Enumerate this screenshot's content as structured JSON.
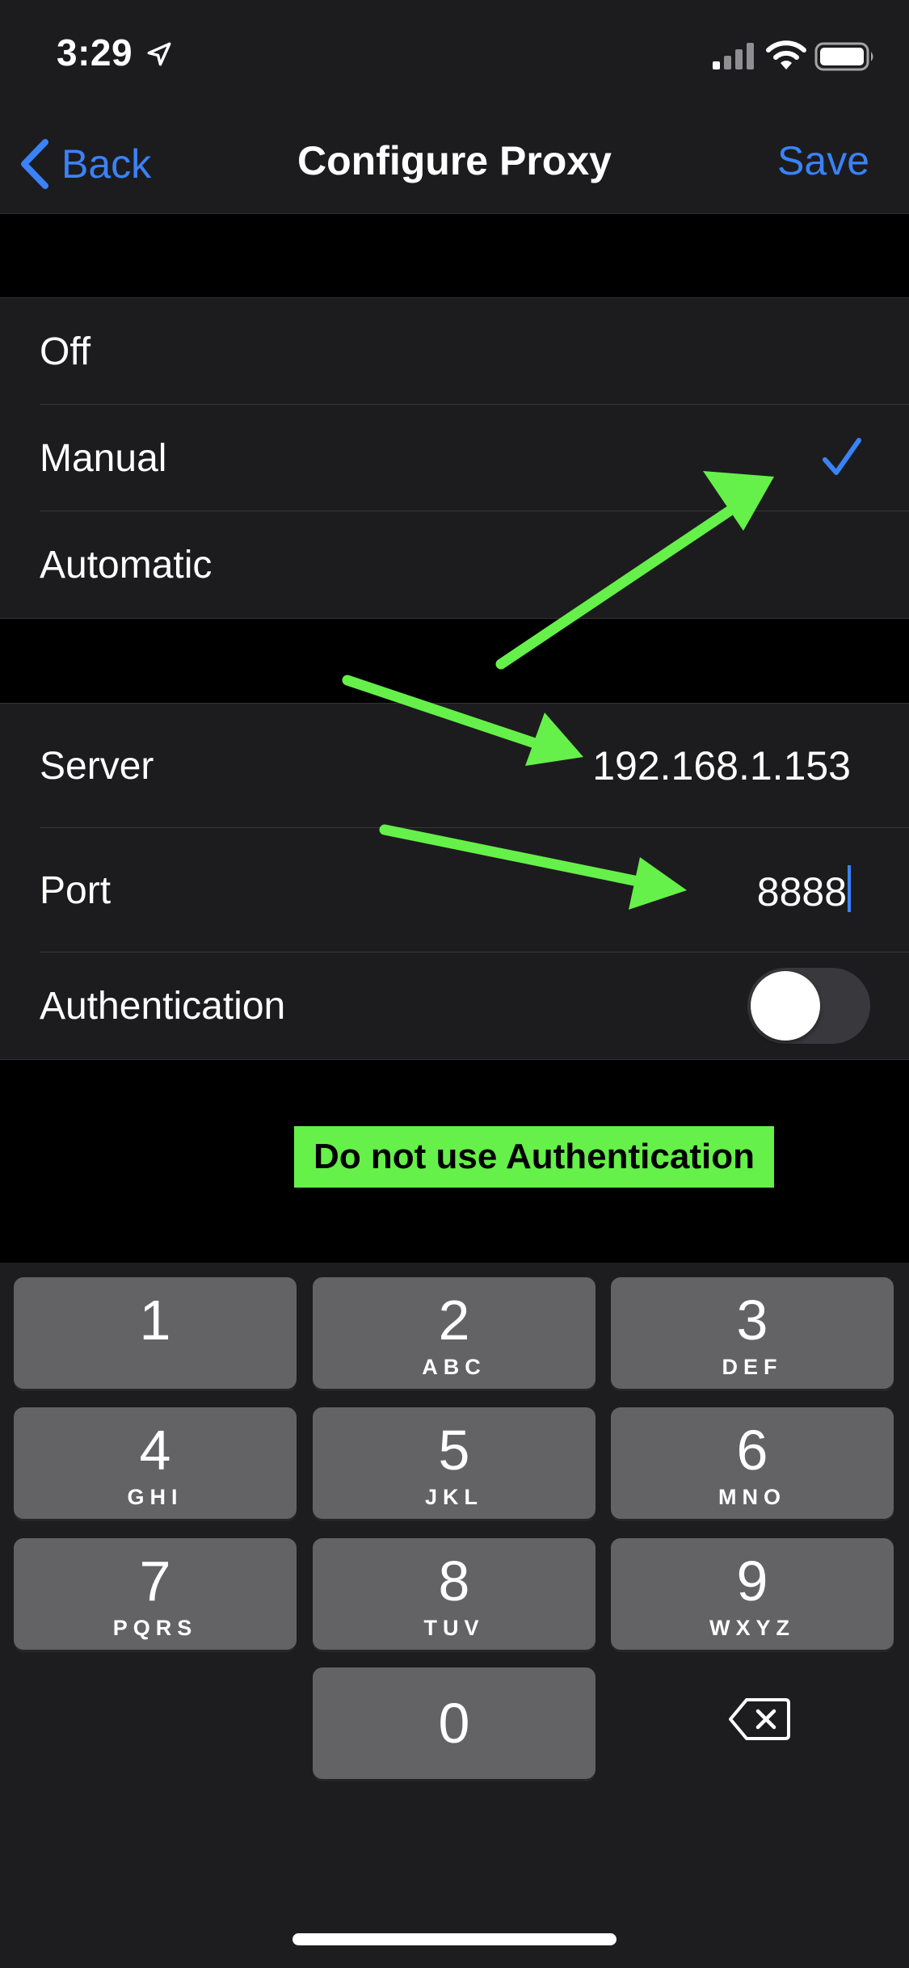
{
  "status_bar": {
    "time": "3:29"
  },
  "nav": {
    "back_label": "Back",
    "title": "Configure Proxy",
    "save_label": "Save"
  },
  "proxy_modes": {
    "items": [
      {
        "label": "Off"
      },
      {
        "label": "Manual"
      },
      {
        "label": "Automatic"
      }
    ],
    "selected": "Manual"
  },
  "config": {
    "server_label": "Server",
    "server_value": "192.168.1.153",
    "port_label": "Port",
    "port_value": "8888",
    "auth_label": "Authentication",
    "auth_enabled": false
  },
  "annotation": {
    "note": "Do not use Authentication",
    "color": "#66f04a"
  },
  "keypad": {
    "keys": [
      {
        "num": "1",
        "letters": ""
      },
      {
        "num": "2",
        "letters": "ABC"
      },
      {
        "num": "3",
        "letters": "DEF"
      },
      {
        "num": "4",
        "letters": "GHI"
      },
      {
        "num": "5",
        "letters": "JKL"
      },
      {
        "num": "6",
        "letters": "MNO"
      },
      {
        "num": "7",
        "letters": "PQRS"
      },
      {
        "num": "8",
        "letters": "TUV"
      },
      {
        "num": "9",
        "letters": "WXYZ"
      },
      {
        "num": "0",
        "letters": ""
      }
    ]
  },
  "colors": {
    "accent": "#3a82f7",
    "background": "#000000",
    "cell": "#1c1c1e",
    "key": "#636366"
  }
}
